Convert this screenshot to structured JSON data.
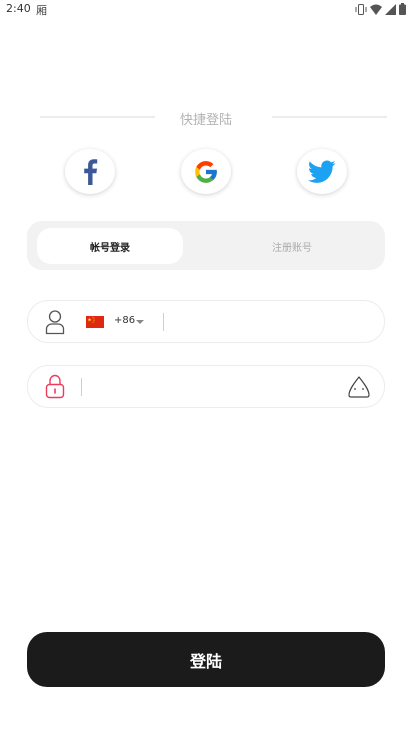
{
  "status_bar": {
    "time": "2:40",
    "notification_glyph": "厢",
    "icons": [
      "vibrate-icon",
      "wifi-icon",
      "signal-icon",
      "battery-icon"
    ]
  },
  "quick_login": {
    "label": "快捷登陆",
    "providers": [
      "facebook-icon",
      "google-icon",
      "twitter-icon"
    ]
  },
  "tabs": {
    "account_login": "帐号登录",
    "register": "注册账号",
    "active": "account_login"
  },
  "phone_field": {
    "country_flag": "china-flag-icon",
    "country_code": "+86",
    "value": "",
    "placeholder": ""
  },
  "password_field": {
    "value": "",
    "placeholder": ""
  },
  "login_button": {
    "label": "登陆"
  },
  "colors": {
    "facebook": "#3b5998",
    "twitter": "#1da1f2",
    "lock": "#ee3b5b",
    "button_bg": "#1b1b1b",
    "tab_bg": "#f2f2f2"
  }
}
